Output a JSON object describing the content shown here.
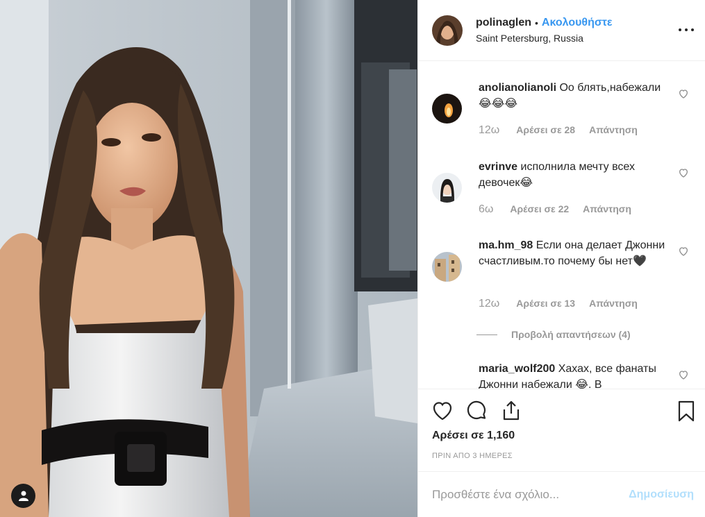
{
  "post": {
    "username": "polinaglen",
    "separator": "•",
    "follow_label": "Ακολουθήστε",
    "location": "Saint Petersburg, Russia",
    "more_icon": "more-options-icon"
  },
  "comments": [
    {
      "user": "anolianolianoli",
      "text": "Оо блять,набежали😂😂😂",
      "time": "12ω",
      "likes": "Αρέσει σε 28",
      "reply": "Απάντηση"
    },
    {
      "user": "evrinve",
      "text": "исполнила мечту всех девочек😂",
      "time": "6ω",
      "likes": "Αρέσει σε 22",
      "reply": "Απάντηση"
    },
    {
      "user": "ma.hm_98",
      "text": "Если она делает Джонни счастливым.то почему бы нет🖤",
      "time": "12ω",
      "likes": "Αρέσει σε 13",
      "reply": "Απάντηση"
    },
    {
      "user": "maria_wolf200",
      "text": "Хахах, все фанаты Джонни набежали 😂. В"
    }
  ],
  "view_replies": "Προβολή απαντήσεων (4)",
  "likes_total": "Αρέσει σε 1,160",
  "posted_ago": "ΠΡΙΝ ΑΠΟ 3 ΗΜΕΡΕΣ",
  "add_comment": {
    "placeholder": "Προσθέστε ένα σχόλιο...",
    "publish_label": "Δημοσίευση"
  },
  "colors": {
    "accent": "#3897f0",
    "publish_disabled": "#b2dffc",
    "muted": "#999999"
  }
}
